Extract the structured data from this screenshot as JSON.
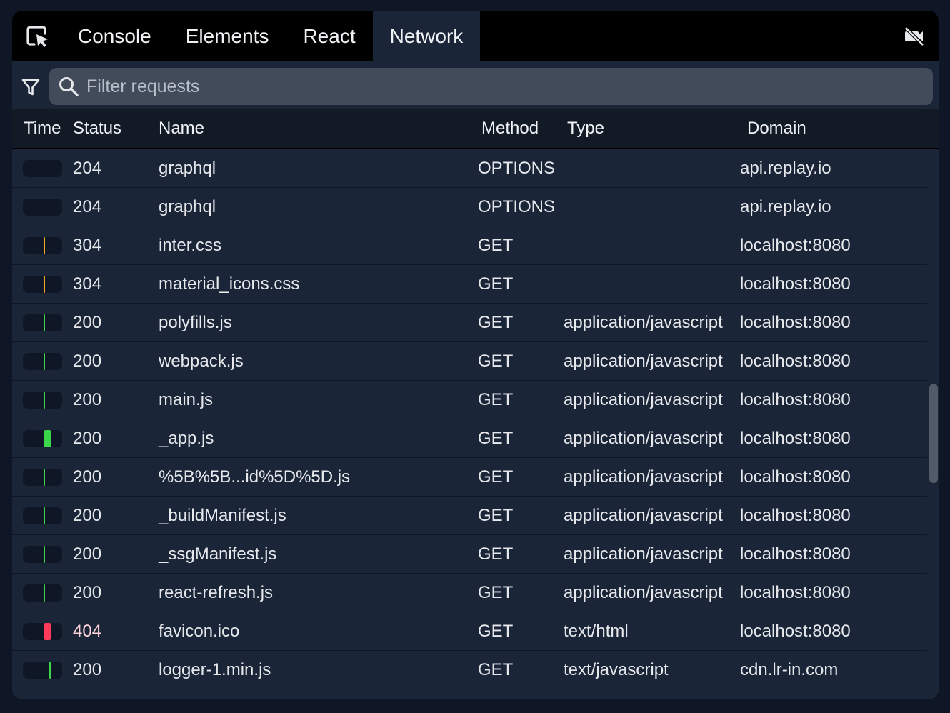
{
  "tabs": [
    {
      "label": "Console",
      "active": false
    },
    {
      "label": "Elements",
      "active": false
    },
    {
      "label": "React",
      "active": false
    },
    {
      "label": "Network",
      "active": true
    }
  ],
  "filter": {
    "placeholder": "Filter requests"
  },
  "columns": {
    "time": "Time",
    "status": "Status",
    "name": "Name",
    "method": "Method",
    "type": "Type",
    "domain": "Domain"
  },
  "colors": {
    "ok": "#3bd64a",
    "redirect": "#f5a623",
    "error": "#ff3b5c"
  },
  "icons": {
    "picker": "element-picker-icon",
    "camera": "video-off-icon",
    "filter": "funnel-icon",
    "search": "search-icon"
  },
  "scroll": {
    "position": 0.52,
    "visible_fraction": 0.18
  },
  "rows": [
    {
      "status": "204",
      "name": "graphql",
      "method": "OPTIONS",
      "type": "",
      "domain": "api.replay.io",
      "timing": {
        "start": 0.0,
        "width": 0.0,
        "kind": "none"
      }
    },
    {
      "status": "204",
      "name": "graphql",
      "method": "OPTIONS",
      "type": "",
      "domain": "api.replay.io",
      "timing": {
        "start": 0.0,
        "width": 0.0,
        "kind": "none"
      }
    },
    {
      "status": "304",
      "name": "inter.css",
      "method": "GET",
      "type": "",
      "domain": "localhost:8080",
      "timing": {
        "start": 0.52,
        "width": 0.04,
        "kind": "redirect"
      }
    },
    {
      "status": "304",
      "name": "material_icons.css",
      "method": "GET",
      "type": "",
      "domain": "localhost:8080",
      "timing": {
        "start": 0.52,
        "width": 0.04,
        "kind": "redirect"
      }
    },
    {
      "status": "200",
      "name": "polyfills.js",
      "method": "GET",
      "type": "application/javascript",
      "domain": "localhost:8080",
      "timing": {
        "start": 0.52,
        "width": 0.04,
        "kind": "ok"
      }
    },
    {
      "status": "200",
      "name": "webpack.js",
      "method": "GET",
      "type": "application/javascript",
      "domain": "localhost:8080",
      "timing": {
        "start": 0.52,
        "width": 0.04,
        "kind": "ok"
      }
    },
    {
      "status": "200",
      "name": "main.js",
      "method": "GET",
      "type": "application/javascript",
      "domain": "localhost:8080",
      "timing": {
        "start": 0.52,
        "width": 0.04,
        "kind": "ok"
      }
    },
    {
      "status": "200",
      "name": "_app.js",
      "method": "GET",
      "type": "application/javascript",
      "domain": "localhost:8080",
      "timing": {
        "start": 0.52,
        "width": 0.2,
        "kind": "ok"
      }
    },
    {
      "status": "200",
      "name": "%5B%5B...id%5D%5D.js",
      "method": "GET",
      "type": "application/javascript",
      "domain": "localhost:8080",
      "timing": {
        "start": 0.52,
        "width": 0.04,
        "kind": "ok"
      }
    },
    {
      "status": "200",
      "name": "_buildManifest.js",
      "method": "GET",
      "type": "application/javascript",
      "domain": "localhost:8080",
      "timing": {
        "start": 0.52,
        "width": 0.04,
        "kind": "ok"
      }
    },
    {
      "status": "200",
      "name": "_ssgManifest.js",
      "method": "GET",
      "type": "application/javascript",
      "domain": "localhost:8080",
      "timing": {
        "start": 0.52,
        "width": 0.04,
        "kind": "ok"
      }
    },
    {
      "status": "200",
      "name": "react-refresh.js",
      "method": "GET",
      "type": "application/javascript",
      "domain": "localhost:8080",
      "timing": {
        "start": 0.52,
        "width": 0.04,
        "kind": "ok"
      }
    },
    {
      "status": "404",
      "name": "favicon.ico",
      "method": "GET",
      "type": "text/html",
      "domain": "localhost:8080",
      "timing": {
        "start": 0.52,
        "width": 0.2,
        "kind": "error"
      }
    },
    {
      "status": "200",
      "name": "logger-1.min.js",
      "method": "GET",
      "type": "text/javascript",
      "domain": "cdn.lr-in.com",
      "timing": {
        "start": 0.68,
        "width": 0.06,
        "kind": "ok"
      }
    }
  ]
}
